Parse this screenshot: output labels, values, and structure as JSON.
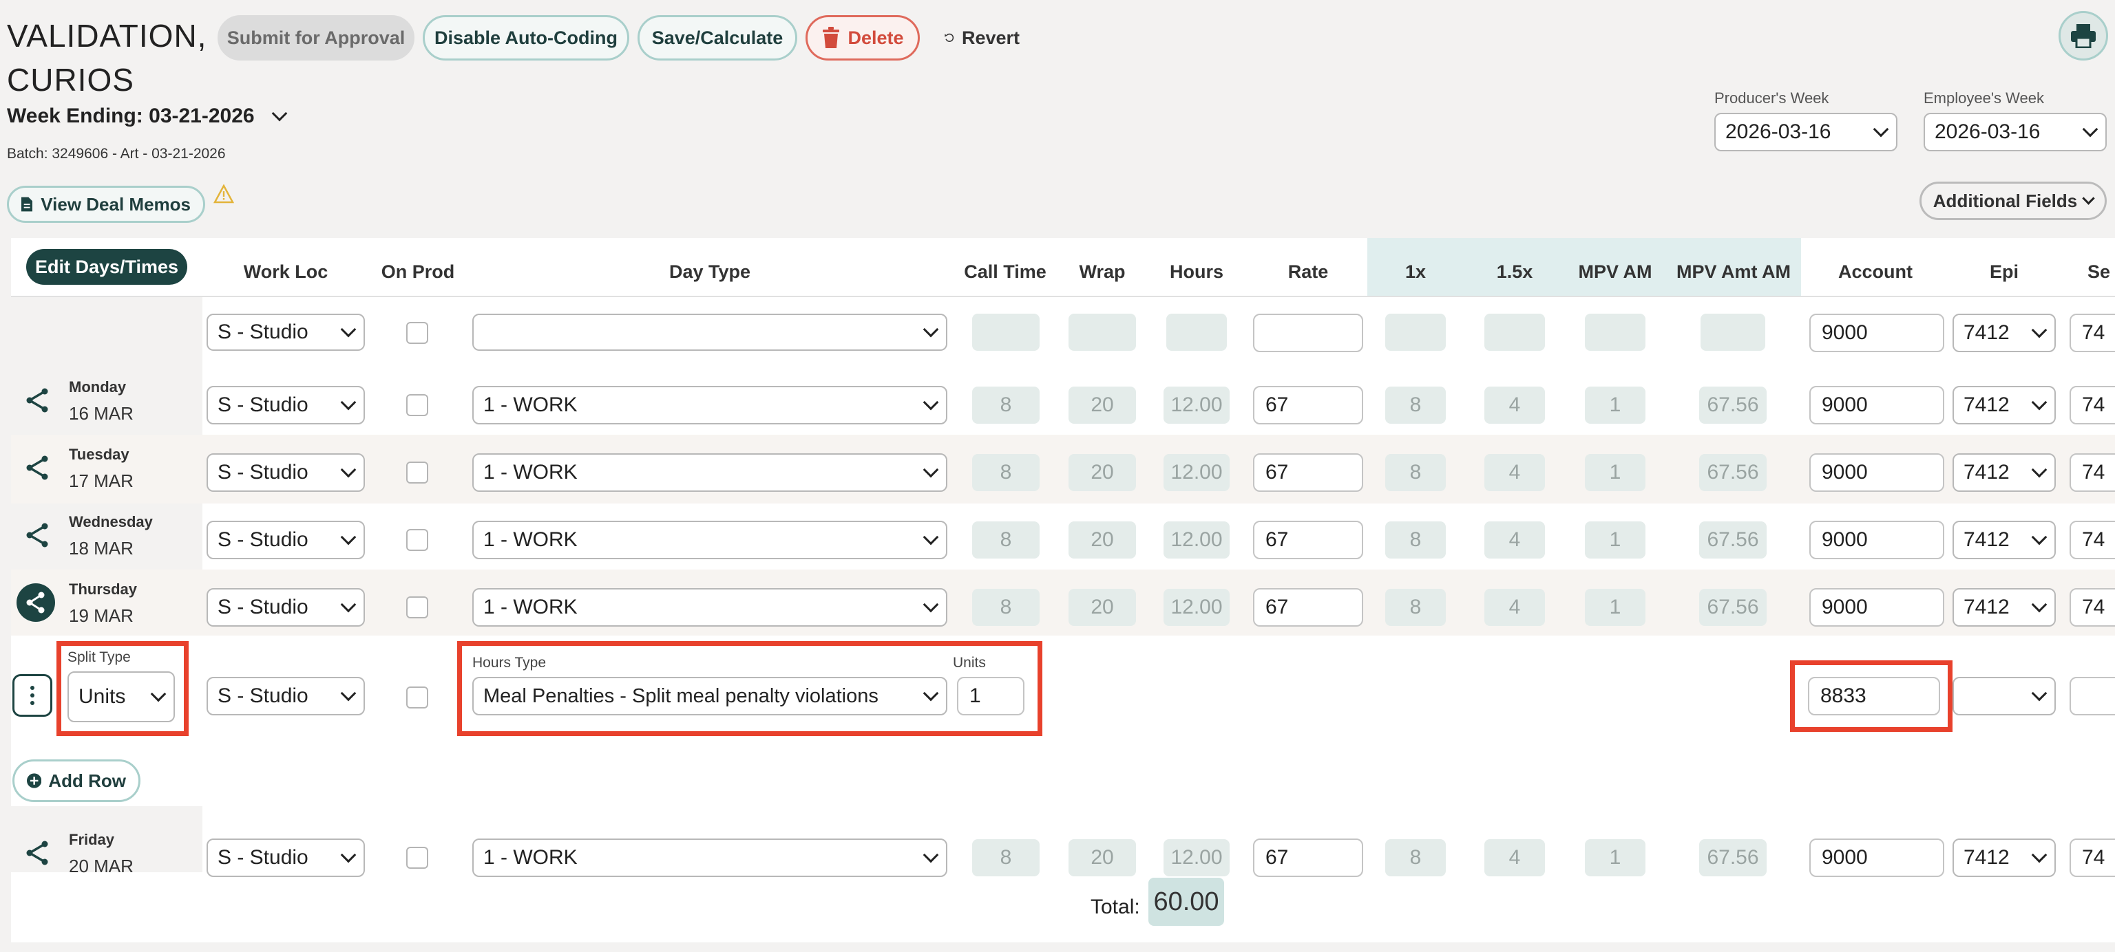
{
  "header": {
    "title_line1": "VALIDATION,",
    "title_line2": "CURIOS",
    "week_ending": "Week Ending: 03-21-2026",
    "batch": "Batch: 3249606 - Art - 03-21-2026"
  },
  "toolbar": {
    "submit": "Submit for Approval",
    "disable_autocoding": "Disable Auto-Coding",
    "save_calculate": "Save/Calculate",
    "delete": "Delete",
    "revert": "Revert"
  },
  "weeks": {
    "producer_label": "Producer's Week",
    "producer_value": "2026-03-16",
    "employee_label": "Employee's Week",
    "employee_value": "2026-03-16"
  },
  "view_deal_memos": "View Deal Memos",
  "additional_fields": "Additional Fields",
  "table": {
    "edit_days_times": "Edit Days/Times",
    "columns": {
      "work_loc": "Work Loc",
      "on_prod": "On Prod",
      "day_type": "Day Type",
      "call_time": "Call Time",
      "wrap": "Wrap",
      "hours": "Hours",
      "rate": "Rate",
      "x1": "1x",
      "x15": "1.5x",
      "mpv_am": "MPV AM",
      "mpv_amt_am": "MPV Amt AM",
      "account": "Account",
      "epi": "Epi",
      "se": "Se"
    },
    "template_row": {
      "work_loc": "S - Studio",
      "day_type": "",
      "rate": "",
      "account": "9000",
      "epi": "7412",
      "se": "74"
    },
    "days": [
      {
        "name": "Monday",
        "date": "16 MAR",
        "work_loc": "S - Studio",
        "day_type": "1 - WORK",
        "call": "8",
        "wrap": "20",
        "hours": "12.00",
        "rate": "67",
        "x1": "8",
        "x15": "4",
        "mpv": "1",
        "mpv_amt": "67.56",
        "account": "9000",
        "epi": "7412",
        "se": "74"
      },
      {
        "name": "Tuesday",
        "date": "17 MAR",
        "work_loc": "S - Studio",
        "day_type": "1 - WORK",
        "call": "8",
        "wrap": "20",
        "hours": "12.00",
        "rate": "67",
        "x1": "8",
        "x15": "4",
        "mpv": "1",
        "mpv_amt": "67.56",
        "account": "9000",
        "epi": "7412",
        "se": "74"
      },
      {
        "name": "Wednesday",
        "date": "18 MAR",
        "work_loc": "S - Studio",
        "day_type": "1 - WORK",
        "call": "8",
        "wrap": "20",
        "hours": "12.00",
        "rate": "67",
        "x1": "8",
        "x15": "4",
        "mpv": "1",
        "mpv_amt": "67.56",
        "account": "9000",
        "epi": "7412",
        "se": "74"
      },
      {
        "name": "Thursday",
        "date": "19 MAR",
        "work_loc": "S - Studio",
        "day_type": "1 - WORK",
        "call": "8",
        "wrap": "20",
        "hours": "12.00",
        "rate": "67",
        "x1": "8",
        "x15": "4",
        "mpv": "1",
        "mpv_amt": "67.56",
        "account": "9000",
        "epi": "7412",
        "se": "74"
      }
    ],
    "split_row": {
      "split_type_label": "Split Type",
      "split_type_value": "Units",
      "work_loc": "S - Studio",
      "hours_type_label": "Hours Type",
      "hours_type_value": "Meal Penalties - Split meal penalty violations",
      "units_label": "Units",
      "units_value": "1",
      "account": "8833"
    },
    "add_row": "Add Row",
    "friday": {
      "name": "Friday",
      "date": "20 MAR",
      "work_loc": "S - Studio",
      "day_type": "1 - WORK",
      "call": "8",
      "wrap": "20",
      "hours": "12.00",
      "rate": "67",
      "x1": "8",
      "x15": "4",
      "mpv": "1",
      "mpv_amt": "67.56",
      "account": "9000",
      "epi": "7412",
      "se": "74"
    },
    "total_label": "Total:",
    "total_value": "60.00"
  },
  "colors": {
    "accent_dark": "#1d4442",
    "accent_light": "#a9cfcb",
    "highlight_red": "#e8412c",
    "delete_red": "#d24b3c"
  }
}
